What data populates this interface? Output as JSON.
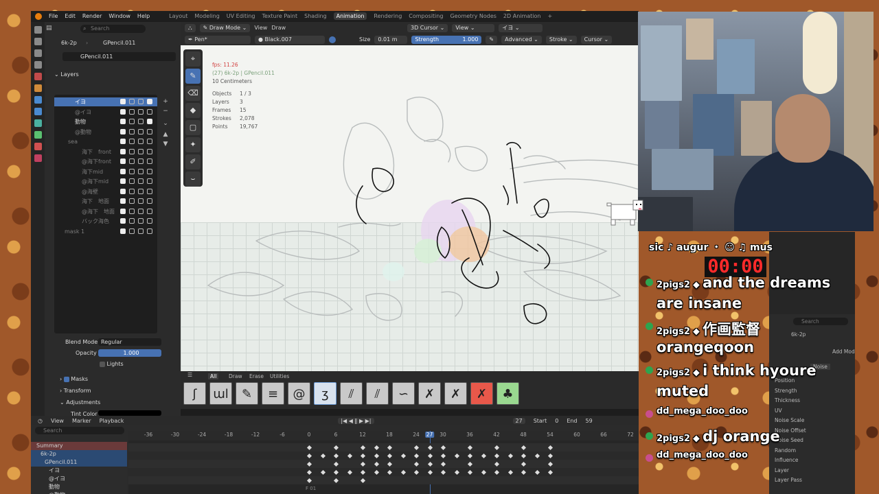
{
  "menu": [
    "File",
    "Edit",
    "Render",
    "Window",
    "Help"
  ],
  "workspaces": [
    "Layout",
    "Modeling",
    "UV Editing",
    "Texture Paint",
    "Shading",
    "Animation",
    "Rendering",
    "Compositing",
    "Geometry Nodes",
    "2D Animation",
    "+"
  ],
  "active_workspace": "Animation",
  "properties": {
    "search_placeholder": "Search",
    "object": "6k-2p",
    "data": "GPencil.011",
    "datablock": "GPencil.011",
    "layers_title": "Layers",
    "layers": [
      {
        "name": "イヨ",
        "sel": true,
        "dim": false,
        "indent": 0
      },
      {
        "name": "@イヨ",
        "sel": false,
        "dim": true,
        "indent": 0
      },
      {
        "name": "動物",
        "sel": false,
        "dim": false,
        "indent": 0
      },
      {
        "name": "@動物",
        "sel": false,
        "dim": true,
        "indent": 0
      },
      {
        "name": "sea",
        "sel": false,
        "dim": true,
        "indent": -10
      },
      {
        "name": "海下　front",
        "sel": false,
        "dim": true,
        "indent": 10
      },
      {
        "name": "@海下front",
        "sel": false,
        "dim": true,
        "indent": 10
      },
      {
        "name": "海下mid",
        "sel": false,
        "dim": true,
        "indent": 10
      },
      {
        "name": "@海下mid",
        "sel": false,
        "dim": true,
        "indent": 10
      },
      {
        "name": "@海壁",
        "sel": false,
        "dim": true,
        "indent": 10
      },
      {
        "name": "海下　地面",
        "sel": false,
        "dim": true,
        "indent": 10
      },
      {
        "name": "@海下　地面",
        "sel": false,
        "dim": true,
        "indent": 10
      },
      {
        "name": "バック海色",
        "sel": false,
        "dim": true,
        "indent": 10
      },
      {
        "name": "mask 1",
        "sel": false,
        "dim": true,
        "indent": -15
      }
    ],
    "blend_mode_label": "Blend Mode",
    "blend_mode": "Regular",
    "opacity_label": "Opacity",
    "opacity": "1.000",
    "lights": "Lights",
    "masks": "Masks",
    "transform": "Transform",
    "adjustments": "Adjustments",
    "tint_color": "Tint Color"
  },
  "viewport": {
    "mode": "Draw Mode",
    "view": "View",
    "draw": "Draw",
    "cursor3d": "3D Cursor",
    "view2": "View",
    "layer": "イヨ",
    "brush": "Pen*",
    "material": "Black.007",
    "size_label": "Size",
    "size": "0.01 m",
    "strength_label": "Strength",
    "strength": "1.000",
    "advanced": "Advanced",
    "stroke": "Stroke",
    "cursor": "Cursor",
    "fps": "fps: 11.26",
    "context": "(27) 6k-2p | GPencil.011",
    "scale": "10 Centimeters",
    "stats": [
      {
        "k": "Objects",
        "v": "1 / 3"
      },
      {
        "k": "Layers",
        "v": "3"
      },
      {
        "k": "Frames",
        "v": "15"
      },
      {
        "k": "Strokes",
        "v": "2,078"
      },
      {
        "k": "Points",
        "v": "19,767"
      }
    ]
  },
  "brush_tabs": [
    "All",
    "Draw",
    "Erase",
    "Utilities"
  ],
  "dopesheet": {
    "menus": [
      "View",
      "Marker",
      "Playback"
    ],
    "current_frame": "27",
    "start_label": "Start",
    "start": "0",
    "end_label": "End",
    "end": "59",
    "search_placeholder": "Search",
    "ruler": [
      "-36",
      "-30",
      "-24",
      "-18",
      "-12",
      "-6",
      "0",
      "6",
      "12",
      "18",
      "24",
      "27",
      "30",
      "36",
      "42",
      "48",
      "54",
      "60",
      "66",
      "72"
    ],
    "channels": [
      "Summary",
      "6k-2p",
      "GPencil.011",
      "イヨ",
      "@イヨ",
      "動物",
      "@動物"
    ],
    "frame_label": "F 01"
  },
  "overlay": {
    "music": "sic ♪ augur ・ ☺        ♫ mus",
    "timer": "00:00",
    "chat": [
      {
        "user": "2pigs2",
        "msg": "and the dreams",
        "cont": "are insane"
      },
      {
        "user": "2pigs2",
        "msg": "作画監督",
        "cont": "orangeqoon"
      },
      {
        "user": "2pigs2",
        "msg": "i think hyoure",
        "cont": "muted"
      },
      {
        "user": "dd_mega_doo_doo",
        "msg": "",
        "cont": ""
      },
      {
        "user": "2pigs2",
        "msg": "dj orange",
        "cont": ""
      },
      {
        "user": "dd_mega_doo_doo",
        "msg": "",
        "cont": ""
      }
    ]
  },
  "second_blender": {
    "object": "6k-2p",
    "modifier": "Noise",
    "rows": [
      "Position",
      "Strength",
      "Thickness",
      "UV",
      "Noise Scale",
      "Noise Offset",
      "Noise Seed",
      "Random",
      "Influence",
      "Layer",
      "Layer Pass"
    ],
    "add_mod": "Add Mod",
    "search": "Search"
  },
  "colors": {
    "accent": "#4772b3",
    "blender_orange": "#e87d0d",
    "timer_red": "#ff2a2a"
  }
}
